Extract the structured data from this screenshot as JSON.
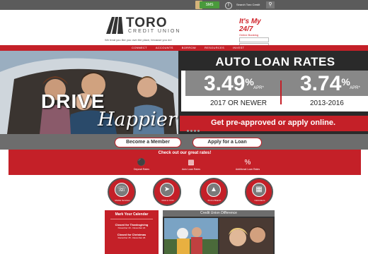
{
  "topbar": {
    "sms_label": "SMS",
    "facebook_icon": "f",
    "search_placeholder": "Search Toro Credit Union",
    "search_icon": "search-icon"
  },
  "logo": {
    "name": "TORO",
    "subtitle": "CREDIT UNION",
    "tagline": "We treat you like you own the place, because you do!"
  },
  "online_banking": {
    "brand": "It's My 24/7",
    "subtitle": "Online Banking",
    "login_label": "Login"
  },
  "nav": {
    "items": [
      "CONNECT",
      "ACCOUNTS",
      "BORROW",
      "RESOURCES",
      "INVEST"
    ]
  },
  "hero": {
    "title": "AUTO LOAN RATES",
    "rate1": "3.49",
    "rate1_pct": "%",
    "rate1_apr": "APR*",
    "rate1_label": "2017 OR NEWER",
    "rate2": "3.74",
    "rate2_pct": "%",
    "rate2_apr": "APR*",
    "rate2_label": "2013-2016",
    "cta": "Get pre-approved or apply online.",
    "drive": "DRIVE",
    "happier": "Happier!"
  },
  "buttons": {
    "member": "Become a Member",
    "loan": "Apply for a Loan"
  },
  "rates": {
    "heading": "Check out our great rates!",
    "items": [
      {
        "label": "Deposit Rates",
        "icon": "piggy-bank-icon"
      },
      {
        "label": "Auto Loan Rates",
        "icon": "car-icon"
      },
      {
        "label": "Additional Loan Rates",
        "icon": "percent-icon"
      }
    ]
  },
  "circles": [
    {
      "label": "Mobile Services",
      "icon": "phone-icon"
    },
    {
      "label": "Click to CON",
      "icon": "arrow-icon"
    },
    {
      "label": "Find a Branch",
      "icon": "branch-icon"
    },
    {
      "label": "Calculators",
      "icon": "calculator-icon"
    }
  ],
  "calendar": {
    "title": "Mark Your Calendar",
    "events": [
      {
        "name": "Closed for Thanksgiving",
        "date": "November 23 - November 24"
      },
      {
        "name": "Closed for Christmas",
        "date": "December 25 - December 26"
      }
    ]
  },
  "difference": {
    "title": "Credit Union Difference"
  },
  "colors": {
    "brand_red": "#c42028",
    "dark_gray": "#5b5b5b",
    "mid_gray": "#6d6d6d",
    "navy": "#2a3d6e"
  }
}
